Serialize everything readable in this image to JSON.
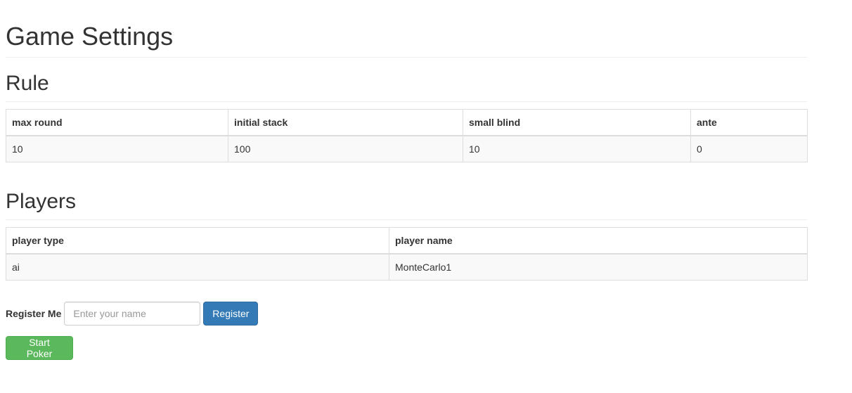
{
  "page": {
    "title": "Game Settings"
  },
  "rule": {
    "heading": "Rule",
    "columns": [
      "max round",
      "initial stack",
      "small blind",
      "ante"
    ],
    "rows": [
      [
        "10",
        "100",
        "10",
        "0"
      ]
    ]
  },
  "players": {
    "heading": "Players",
    "columns": [
      "player type",
      "player name"
    ],
    "rows": [
      [
        "ai",
        "MonteCarlo1"
      ]
    ]
  },
  "register": {
    "label": "Register Me",
    "placeholder": "Enter your name",
    "value": "",
    "button_label": "Register"
  },
  "start_button_label": "Start Poker",
  "colors": {
    "primary": "#337ab7",
    "success": "#5cb85c",
    "text": "#333333",
    "table_stripe": "#f9f9f9",
    "border": "#dddddd"
  }
}
